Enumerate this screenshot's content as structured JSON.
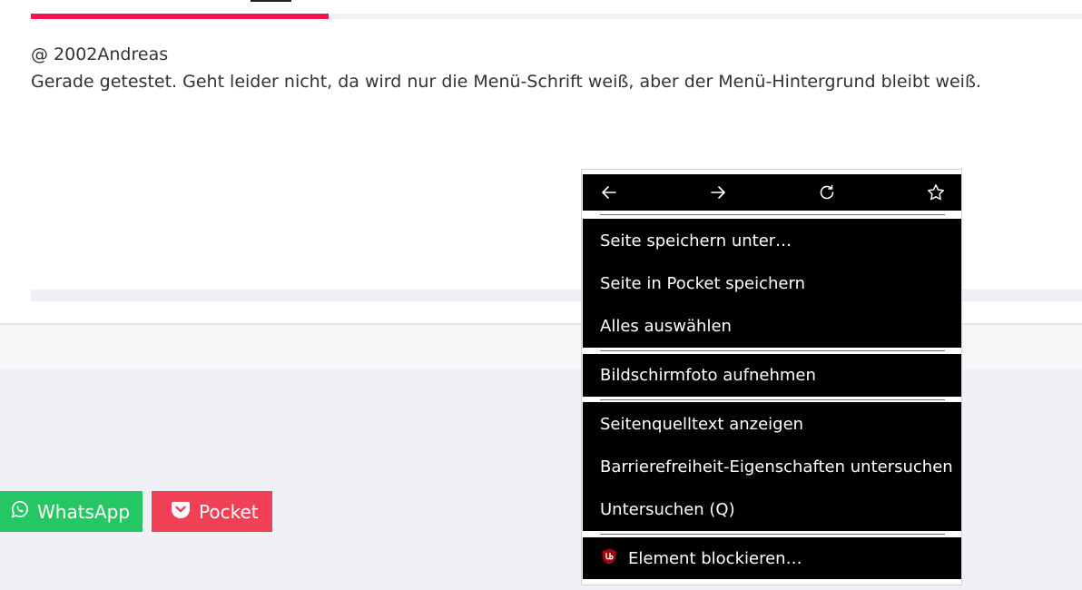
{
  "comment": {
    "author_line": "@ 2002Andreas",
    "body": "Gerade getestet. Geht leider nicht, da wird nur die Menü-Schrift weiß, aber der Menü-Hintergrund bleibt weiß."
  },
  "share": {
    "whatsapp_label": "WhatsApp",
    "pocket_label": "Pocket",
    "whatsapp_color": "#25c765",
    "pocket_color": "#ef4056"
  },
  "accent_color": "#f0154a",
  "context_menu": {
    "nav_icons": [
      "back-arrow-icon",
      "forward-arrow-icon",
      "reload-icon",
      "bookmark-star-icon"
    ],
    "groups": [
      [
        {
          "label": "Seite speichern unter…",
          "access_key": "e"
        },
        {
          "label": "Seite in Pocket speichern",
          "access_key": "o"
        },
        {
          "label": "Alles auswählen",
          "access_key": "u"
        }
      ],
      [
        {
          "label": "Bildschirmfoto aufnehmen",
          "access_key": "a"
        }
      ],
      [
        {
          "label": "Seitenquelltext anzeigen",
          "access_key": "a"
        },
        {
          "label": "Barrierefreiheit-Eigenschaften untersuchen"
        },
        {
          "label": "Untersuchen (Q)",
          "access_key": "Q"
        }
      ],
      [
        {
          "label": "Element blockieren…",
          "icon": "ublock-origin-icon"
        }
      ]
    ]
  }
}
